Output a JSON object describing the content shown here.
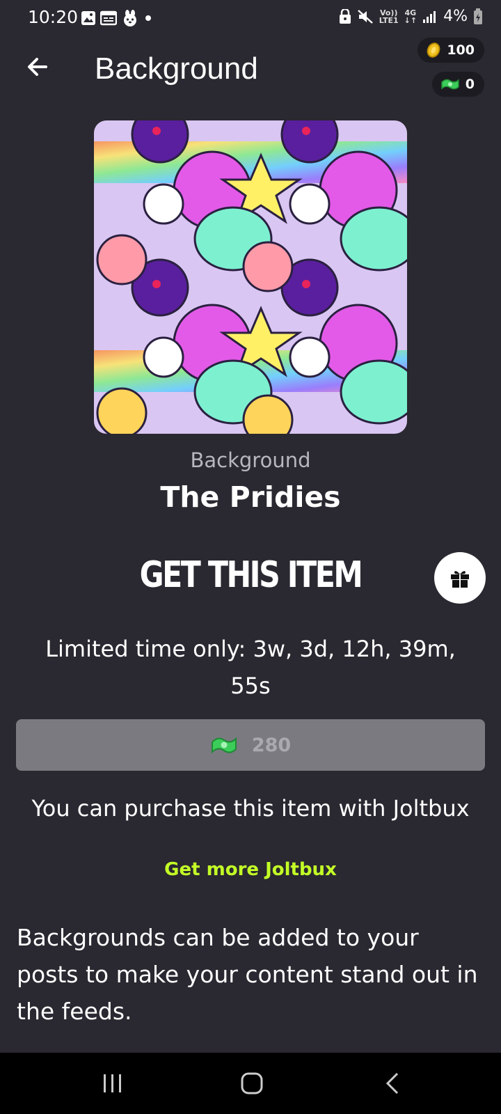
{
  "status_bar": {
    "time": "10:20",
    "network_top": "Vo))",
    "network_bottom": "LTE1",
    "signal_type_top": "4G",
    "battery": "4%",
    "left_icons": [
      "gallery-icon",
      "calendar-icon",
      "bunny-icon",
      "dot-icon"
    ],
    "right_icons": [
      "lock-icon",
      "mute-icon",
      "signal-icon",
      "battery-icon"
    ]
  },
  "header": {
    "title": "Background",
    "coins": "100",
    "joltbux": "0"
  },
  "item": {
    "type_label": "Background",
    "name": "The Pridies"
  },
  "purchase": {
    "section_title": "GET THIS ITEM",
    "limited_time": "Limited time only: 3w, 3d, 12h, 39m, 55s",
    "price": "280",
    "note": "You can purchase this item with Joltbux",
    "get_more": "Get more Joltbux",
    "description": "Backgrounds can be added to your posts to make your content stand out in the feeds."
  },
  "colors": {
    "background": "#2a2830",
    "accent_green": "#c3ff26",
    "price_button": "#7b7a80",
    "coin_gold": "#f0c020",
    "bux_green": "#3ccc5a"
  }
}
